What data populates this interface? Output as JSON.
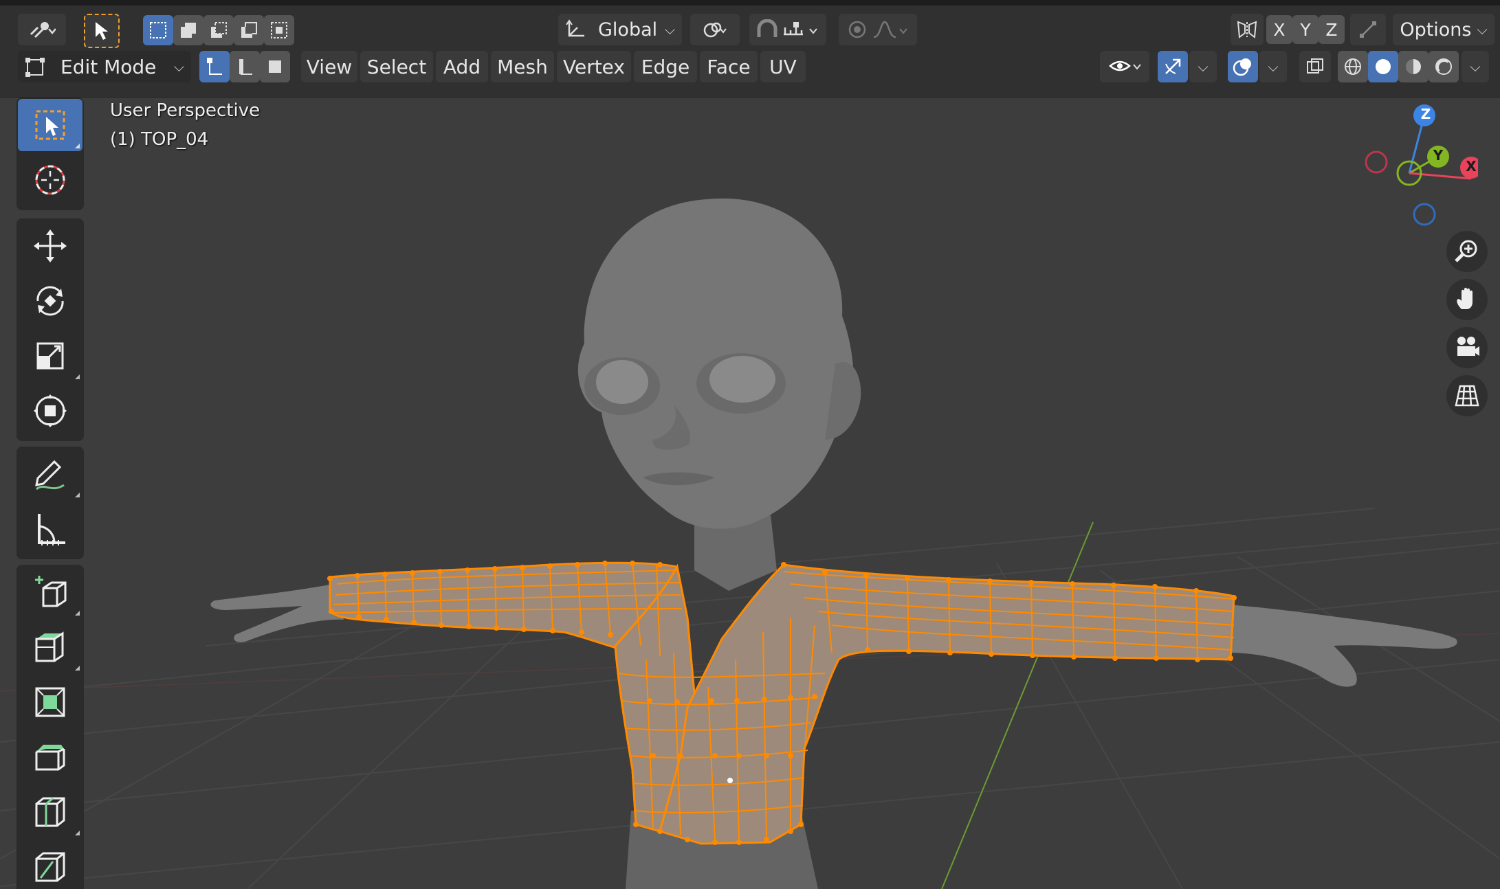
{
  "header": {
    "transform_orientation": "Global",
    "axes": [
      "X",
      "Y",
      "Z"
    ],
    "options_label": "Options"
  },
  "edit_header": {
    "mode_label": "Edit Mode",
    "menus": [
      "View",
      "Select",
      "Add",
      "Mesh",
      "Vertex",
      "Edge",
      "Face",
      "UV"
    ]
  },
  "viewport": {
    "perspective_label": "User Perspective",
    "object_label": "(1) TOP_04"
  },
  "gizmo": {
    "z_label": "Z",
    "y_label": "Y",
    "x_label": "X"
  },
  "colors": {
    "accent": "#4772b3",
    "selection": "#ff8a00",
    "axis_x": "#e8435a",
    "axis_y": "#84b623",
    "axis_z": "#3c85e4"
  },
  "icons": {
    "toolbar": [
      "select-box-icon",
      "cursor-icon",
      "move-icon",
      "rotate-icon",
      "scale-icon",
      "transform-icon",
      "annotate-icon",
      "measure-icon",
      "add-cube-icon",
      "extrude-icon",
      "inset-icon",
      "bevel-icon",
      "loop-cut-icon",
      "knife-icon"
    ],
    "navigation": [
      "zoom-icon",
      "hand-pan-icon",
      "camera-icon",
      "grid-view-icon"
    ]
  }
}
